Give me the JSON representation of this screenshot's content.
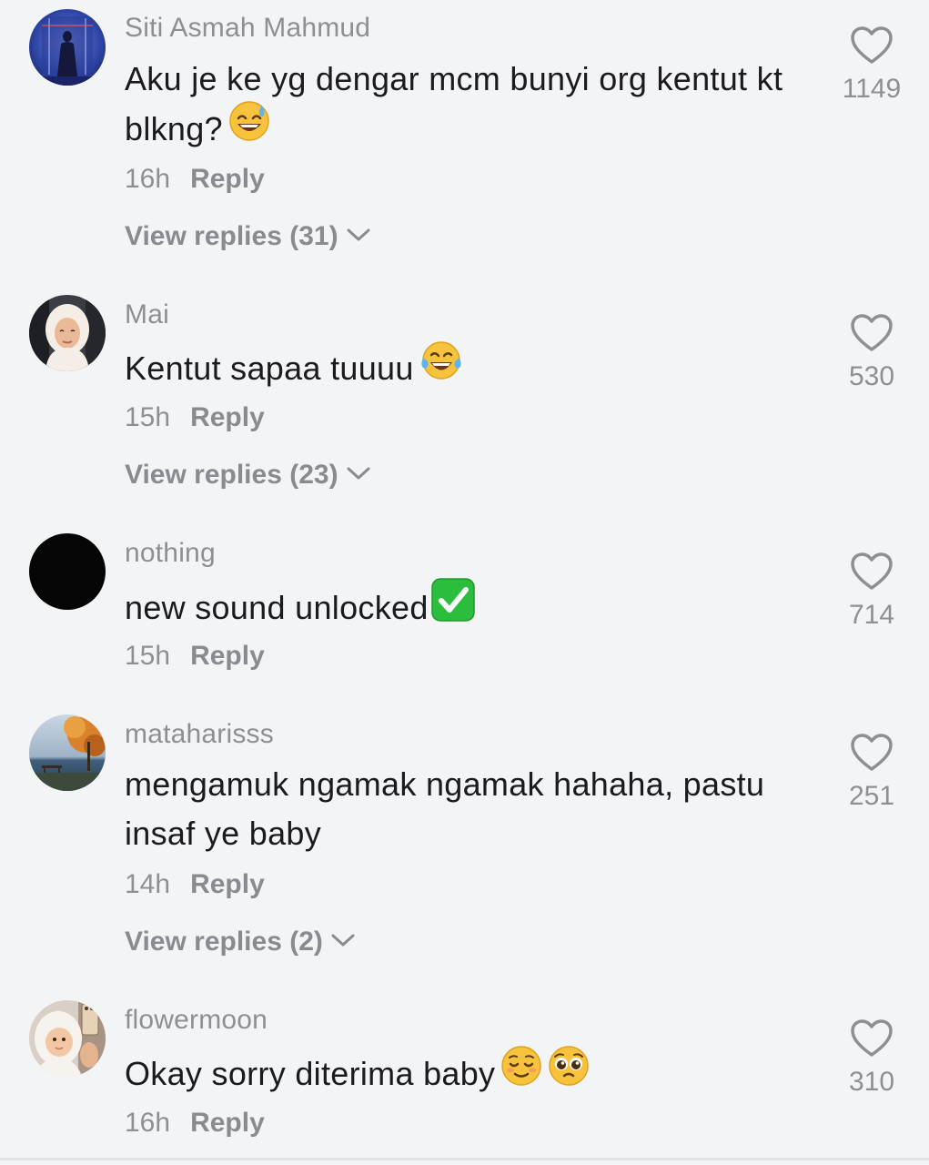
{
  "comments": [
    {
      "username": "Siti Asmah Mahmud",
      "text": "Aku je ke yg dengar mcm bunyi org kentut kt blkng?",
      "emojis": [
        "sweat-smile"
      ],
      "time": "16h",
      "reply_label": "Reply",
      "view_replies": "View replies (31)",
      "likes": "1149"
    },
    {
      "username": "Mai",
      "text": "Kentut sapaa tuuuu",
      "emojis": [
        "tears-of-joy"
      ],
      "time": "15h",
      "reply_label": "Reply",
      "view_replies": "View replies (23)",
      "likes": "530"
    },
    {
      "username": "nothing",
      "text": "new sound unlocked",
      "emojis": [
        "check-mark-button"
      ],
      "time": "15h",
      "reply_label": "Reply",
      "view_replies": null,
      "likes": "714"
    },
    {
      "username": "mataharisss",
      "text": "mengamuk ngamak ngamak hahaha, pastu insaf ye baby",
      "emojis": [],
      "time": "14h",
      "reply_label": "Reply",
      "view_replies": "View replies (2)",
      "likes": "251"
    },
    {
      "username": "flowermoon",
      "text": "Okay sorry diterima baby",
      "emojis": [
        "relieved-face",
        "pleading-face"
      ],
      "time": "16h",
      "reply_label": "Reply",
      "view_replies": null,
      "likes": "310"
    }
  ],
  "icons": {
    "like": "heart-outline-icon",
    "expand": "chevron-down-icon"
  },
  "colors": {
    "background": "#f3f4f6",
    "text": "#1a1a1f",
    "secondary": "#8e8f94"
  }
}
